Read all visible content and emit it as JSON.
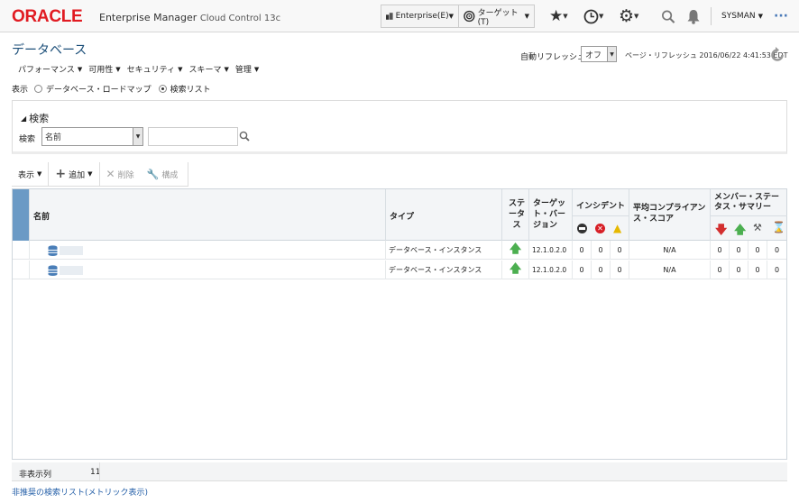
{
  "header": {
    "logo": "ORACLE",
    "product_name": "Enterprise Manager",
    "product_suffix": "Cloud Control 13c",
    "enterprise_menu": "Enterprise(E)",
    "targets_menu": "ターゲット(T)",
    "user": "SYSMAN",
    "more": "···"
  },
  "page": {
    "title": "データベース",
    "menus": [
      "パフォーマンス",
      "可用性",
      "セキュリティ",
      "スキーマ",
      "管理"
    ],
    "auto_refresh_label": "自動リフレッシュ",
    "auto_refresh_value": "オフ",
    "page_refresh_text": "ページ・リフレッシュ 2016/06/22 4:41:53 EDT"
  },
  "display": {
    "label": "表示",
    "options": [
      "データベース・ロードマップ",
      "検索リスト"
    ],
    "selected": "検索リスト"
  },
  "search": {
    "header": "検索",
    "label": "検索",
    "field_value": "名前",
    "input_value": ""
  },
  "toolbar": {
    "view": "表示",
    "add": "追加",
    "delete": "削除",
    "configure": "構成"
  },
  "table": {
    "columns": {
      "name": "名前",
      "type": "タイプ",
      "status": "ステータス",
      "version": "ターゲット・バージョン",
      "incidents": "インシデント",
      "compliance": "平均コンプライアンス・スコア",
      "member_status": "メンバー・ステータス・サマリー"
    },
    "rows": [
      {
        "name": "",
        "type": "データベース・インスタンス",
        "status": "up",
        "version": "12.1.0.2.0",
        "inc_critical": "0",
        "inc_error": "0",
        "inc_warning": "0",
        "compliance": "N/A",
        "mem_down": "0",
        "mem_up": "0",
        "mem_maint": "0",
        "mem_pending": "0"
      },
      {
        "name": "",
        "type": "データベース・インスタンス",
        "status": "up",
        "version": "12.1.0.2.0",
        "inc_critical": "0",
        "inc_error": "0",
        "inc_warning": "0",
        "compliance": "N/A",
        "mem_down": "0",
        "mem_up": "0",
        "mem_maint": "0",
        "mem_pending": "0"
      }
    ]
  },
  "footer": {
    "hidden_columns_label": "非表示列",
    "hidden_columns_value": "11",
    "deprecated_link": "非推奨の検索リスト(メトリック表示)"
  },
  "colors": {
    "oracle_red": "#e11b22",
    "title_blue": "#1c4f79",
    "status_up": "#4caf50",
    "status_down": "#d32f2f",
    "link_blue": "#245fa8"
  }
}
